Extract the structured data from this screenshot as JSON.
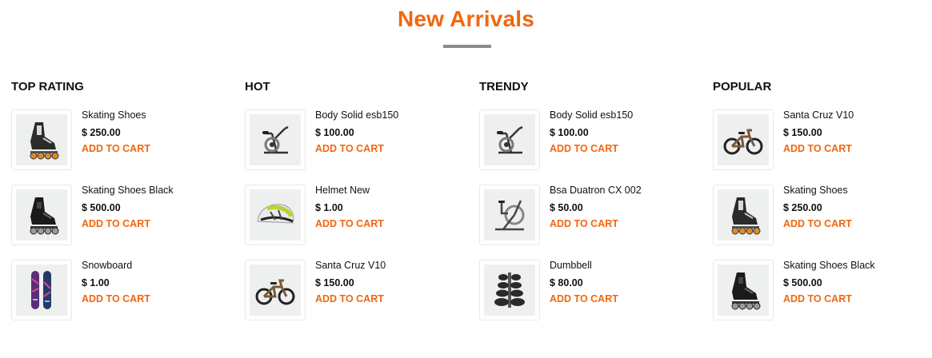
{
  "section_title": "New Arrivals",
  "colors": {
    "accent": "#f2660f",
    "divider": "#8a8a8a",
    "thumb_bg": "#eef0ef"
  },
  "columns": [
    {
      "heading": "TOP RATING",
      "items": [
        {
          "name": "Skating Shoes",
          "price": "$ 250.00",
          "cart": "ADD TO CART",
          "icon": "inline-skate-icon"
        },
        {
          "name": "Skating Shoes Black",
          "price": "$ 500.00",
          "cart": "ADD TO CART",
          "icon": "inline-skate-black-icon"
        },
        {
          "name": "Snowboard",
          "price": "$ 1.00",
          "cart": "ADD TO CART",
          "icon": "snowboard-icon"
        }
      ]
    },
    {
      "heading": "HOT",
      "items": [
        {
          "name": "Body Solid esb150",
          "price": "$ 100.00",
          "cart": "ADD TO CART",
          "icon": "exercise-bike-icon"
        },
        {
          "name": "Helmet New",
          "price": "$ 1.00",
          "cart": "ADD TO CART",
          "icon": "helmet-icon"
        },
        {
          "name": "Santa Cruz V10",
          "price": "$ 150.00",
          "cart": "ADD TO CART",
          "icon": "mountain-bike-icon"
        }
      ]
    },
    {
      "heading": "TRENDY",
      "items": [
        {
          "name": "Body Solid esb150",
          "price": "$ 100.00",
          "cart": "ADD TO CART",
          "icon": "exercise-bike-icon"
        },
        {
          "name": "Bsa Duatron CX 002",
          "price": "$ 50.00",
          "cart": "ADD TO CART",
          "icon": "air-bike-icon"
        },
        {
          "name": "Dumbbell",
          "price": "$ 80.00",
          "cart": "ADD TO CART",
          "icon": "dumbbell-rack-icon"
        }
      ]
    },
    {
      "heading": "POPULAR",
      "items": [
        {
          "name": "Santa Cruz V10",
          "price": "$ 150.00",
          "cart": "ADD TO CART",
          "icon": "mountain-bike-icon"
        },
        {
          "name": "Skating Shoes",
          "price": "$ 250.00",
          "cart": "ADD TO CART",
          "icon": "inline-skate-icon"
        },
        {
          "name": "Skating Shoes Black",
          "price": "$ 500.00",
          "cart": "ADD TO CART",
          "icon": "inline-skate-black-icon"
        }
      ]
    }
  ]
}
